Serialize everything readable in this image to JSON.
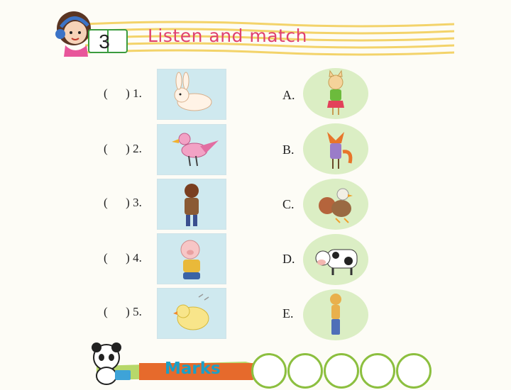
{
  "header": {
    "section_number": "3",
    "title": "Listen and match"
  },
  "left_items": [
    {
      "bracket": "(      ) 1.",
      "animal": "rabbit-picture"
    },
    {
      "bracket": "(      ) 2.",
      "animal": "bird-picture"
    },
    {
      "bracket": "(      ) 3.",
      "animal": "horse-picture"
    },
    {
      "bracket": "(      ) 4.",
      "animal": "pig-picture"
    },
    {
      "bracket": "(      ) 5.",
      "animal": "chick-picture"
    }
  ],
  "right_items": [
    {
      "letter": "A.",
      "animal": "cat-picture"
    },
    {
      "letter": "B.",
      "animal": "fox-picture"
    },
    {
      "letter": "C.",
      "animal": "turkey-duck-picture"
    },
    {
      "letter": "D.",
      "animal": "cow-picture"
    },
    {
      "letter": "E.",
      "animal": "dog-picture"
    }
  ],
  "footer": {
    "marks_label": "Marks",
    "mark_circles": 5
  },
  "colors": {
    "title": "#e0416f",
    "header_lines": "#f3d36a",
    "card_bg": "#cfe9ef",
    "oval_bg": "#dbeec4",
    "marks_text": "#1aa0c8",
    "circle_border": "#8cbf3f"
  }
}
